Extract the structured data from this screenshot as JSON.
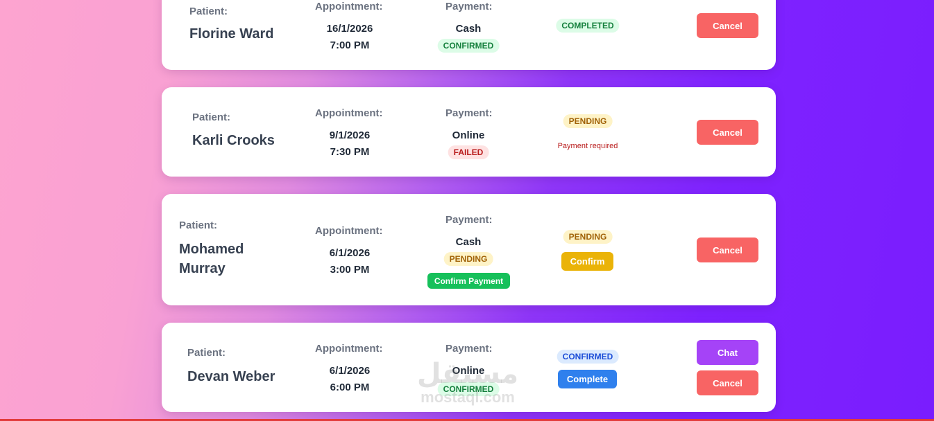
{
  "labels": {
    "patient": "Patient:",
    "appointment": "Appointment:",
    "payment": "Payment:"
  },
  "appointments": [
    {
      "patient": "Florine Ward",
      "date": "16/1/2026",
      "time": "7:00 PM",
      "payment_method": "Cash",
      "payment_status": "CONFIRMED",
      "status": "COMPLETED",
      "cancel_label": "Cancel"
    },
    {
      "patient": "Karli Crooks",
      "date": "9/1/2026",
      "time": "7:30 PM",
      "payment_method": "Online",
      "payment_status": "FAILED",
      "status": "PENDING",
      "status_note": "Payment required",
      "cancel_label": "Cancel"
    },
    {
      "patient_line1": "Mohamed",
      "patient_line2": "Murray",
      "date": "6/1/2026",
      "time": "3:00 PM",
      "payment_method": "Cash",
      "payment_status": "PENDING",
      "confirm_payment_label": "Confirm Payment",
      "status": "PENDING",
      "confirm_label": "Confirm",
      "cancel_label": "Cancel"
    },
    {
      "patient": "Devan Weber",
      "date": "6/1/2026",
      "time": "6:00 PM",
      "payment_method": "Online",
      "payment_status": "CONFIRMED",
      "status": "CONFIRMED",
      "complete_label": "Complete",
      "chat_label": "Chat",
      "cancel_label": "Cancel"
    }
  ],
  "watermark": {
    "arabic": "مستقل",
    "latin": "mostaql.com"
  },
  "colors": {
    "cancel": "#f86464",
    "chat": "#a543f7",
    "complete": "#2f80ed",
    "confirm": "#eab308",
    "confirm_payment": "#16c05a"
  }
}
